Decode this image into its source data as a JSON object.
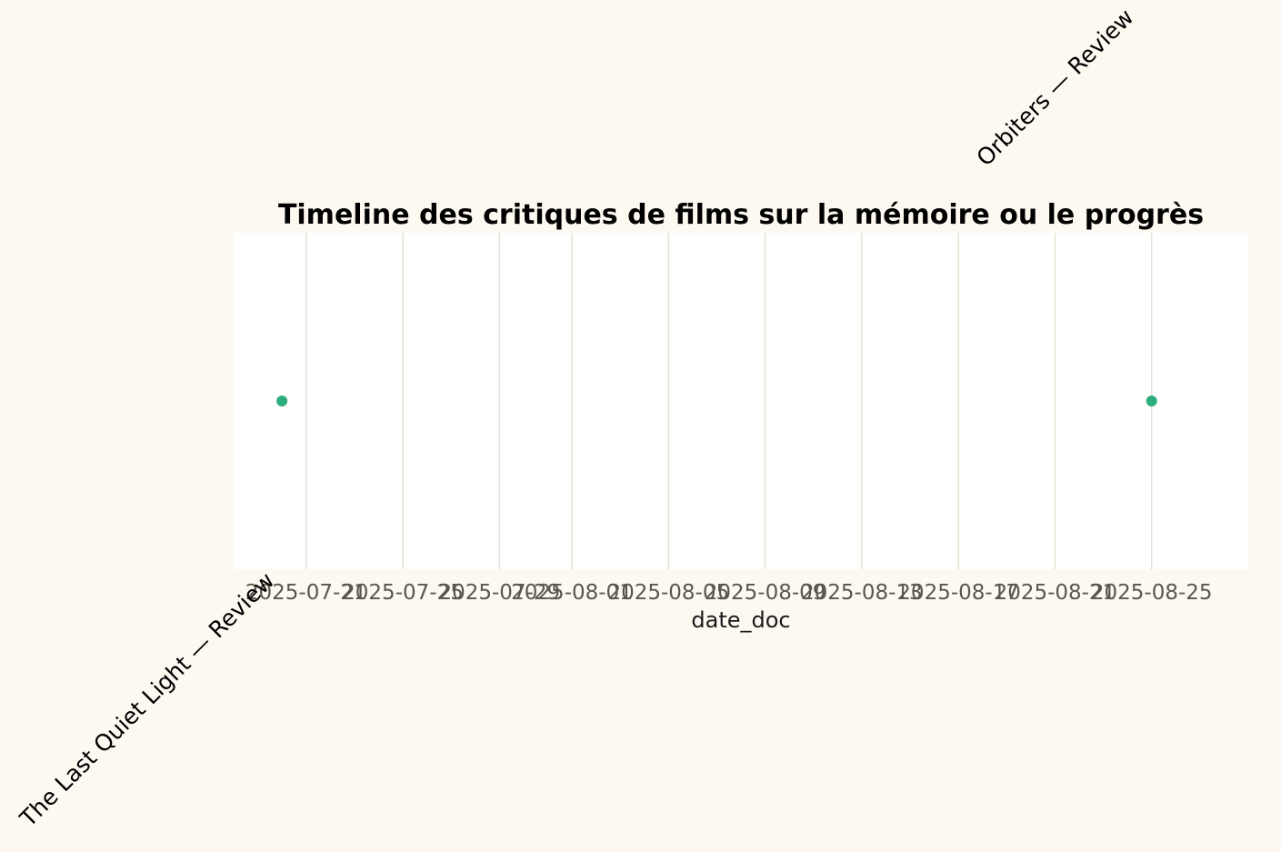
{
  "chart_data": {
    "type": "scatter",
    "title": "Timeline des critiques de films sur la mémoire ou le progrès",
    "xlabel": "date_doc",
    "ylabel": "",
    "x_axis_type": "date",
    "xlim": [
      "2025-07-18",
      "2025-08-29"
    ],
    "x_ticks": [
      "2025-07-21",
      "2025-07-25",
      "2025-07-29",
      "2025-08-01",
      "2025-08-05",
      "2025-08-09",
      "2025-08-13",
      "2025-08-17",
      "2025-08-21",
      "2025-08-25"
    ],
    "y_ticks_visible": false,
    "grid": "vertical",
    "points": [
      {
        "x": "2025-07-20",
        "label": "The Last Quiet Light — Review",
        "label_position": "below"
      },
      {
        "x": "2025-08-25",
        "label": "Orbiters — Review",
        "label_position": "above"
      }
    ],
    "colors": {
      "background": "#fdf9f1",
      "plot_area": "#ffffff",
      "grid": "#e6e1d6",
      "point": "#2bae7c"
    }
  }
}
